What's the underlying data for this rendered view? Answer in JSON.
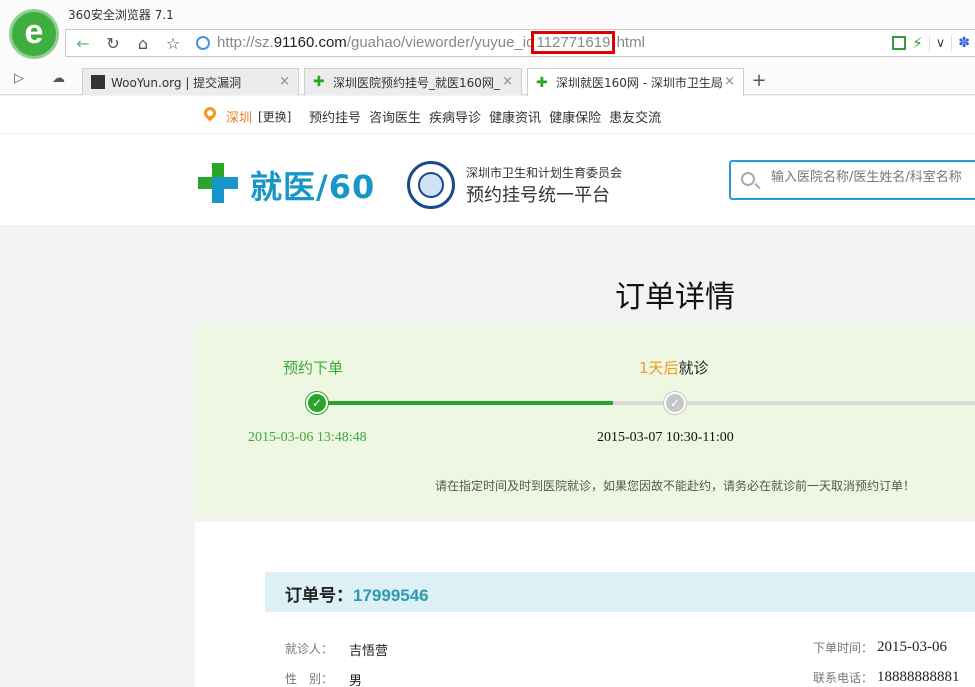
{
  "browser": {
    "app_title": "360安全浏览器 7.1",
    "logo_letter": "e",
    "url_prefix": "http://sz.",
    "url_domain": "91160.com",
    "url_path": "/guahao/vieworder/yuyue_id",
    "url_highlight": "112771619",
    "url_suffix": ".html",
    "tabs": [
      {
        "label": "WooYun.org | 提交漏洞"
      },
      {
        "label": "深圳医院预约挂号_就医160网_"
      },
      {
        "label": "深圳就医160网 - 深圳市卫生局"
      }
    ],
    "close_glyph": "×",
    "new_tab_glyph": "+"
  },
  "site": {
    "city": "深圳",
    "change_city": "[更换]",
    "nav": [
      "预约挂号",
      "咨询医生",
      "疾病导诊",
      "健康资讯",
      "健康保险",
      "患友交流"
    ],
    "logo_text": "就医/60",
    "gov_org": "深圳市卫生和计划生育委员会",
    "gov_platform": "预约挂号统一平台",
    "search_placeholder": "输入医院名称/医生姓名/科室名称"
  },
  "order": {
    "page_title": "订单详情",
    "step1_label": "预约下单",
    "step2_prefix": "1天后",
    "step2_label": "就诊",
    "step1_time": "2015-03-06 13:48:48",
    "step2_time": "2015-03-07 10:30-11:00",
    "progress_fraction": 0.45,
    "notice": "请在指定时间及时到医院就诊，如果您因故不能赴约，请务必在就诊前一天取消预约订单！",
    "order_label": "订单号：",
    "order_number": "17999546",
    "patient_label": "就诊人：",
    "patient_name": "吉悟营",
    "gender_label": "性　别：",
    "gender": "男",
    "order_time_label": "下单时间：",
    "order_time": "2015-03-06",
    "phone_label": "联系电话：",
    "phone": "18888888881"
  },
  "colors": {
    "brand_green": "#2aa52a",
    "brand_blue": "#1696c9",
    "highlight_red": "#e00000",
    "progress_bg": "#eef7e1"
  }
}
